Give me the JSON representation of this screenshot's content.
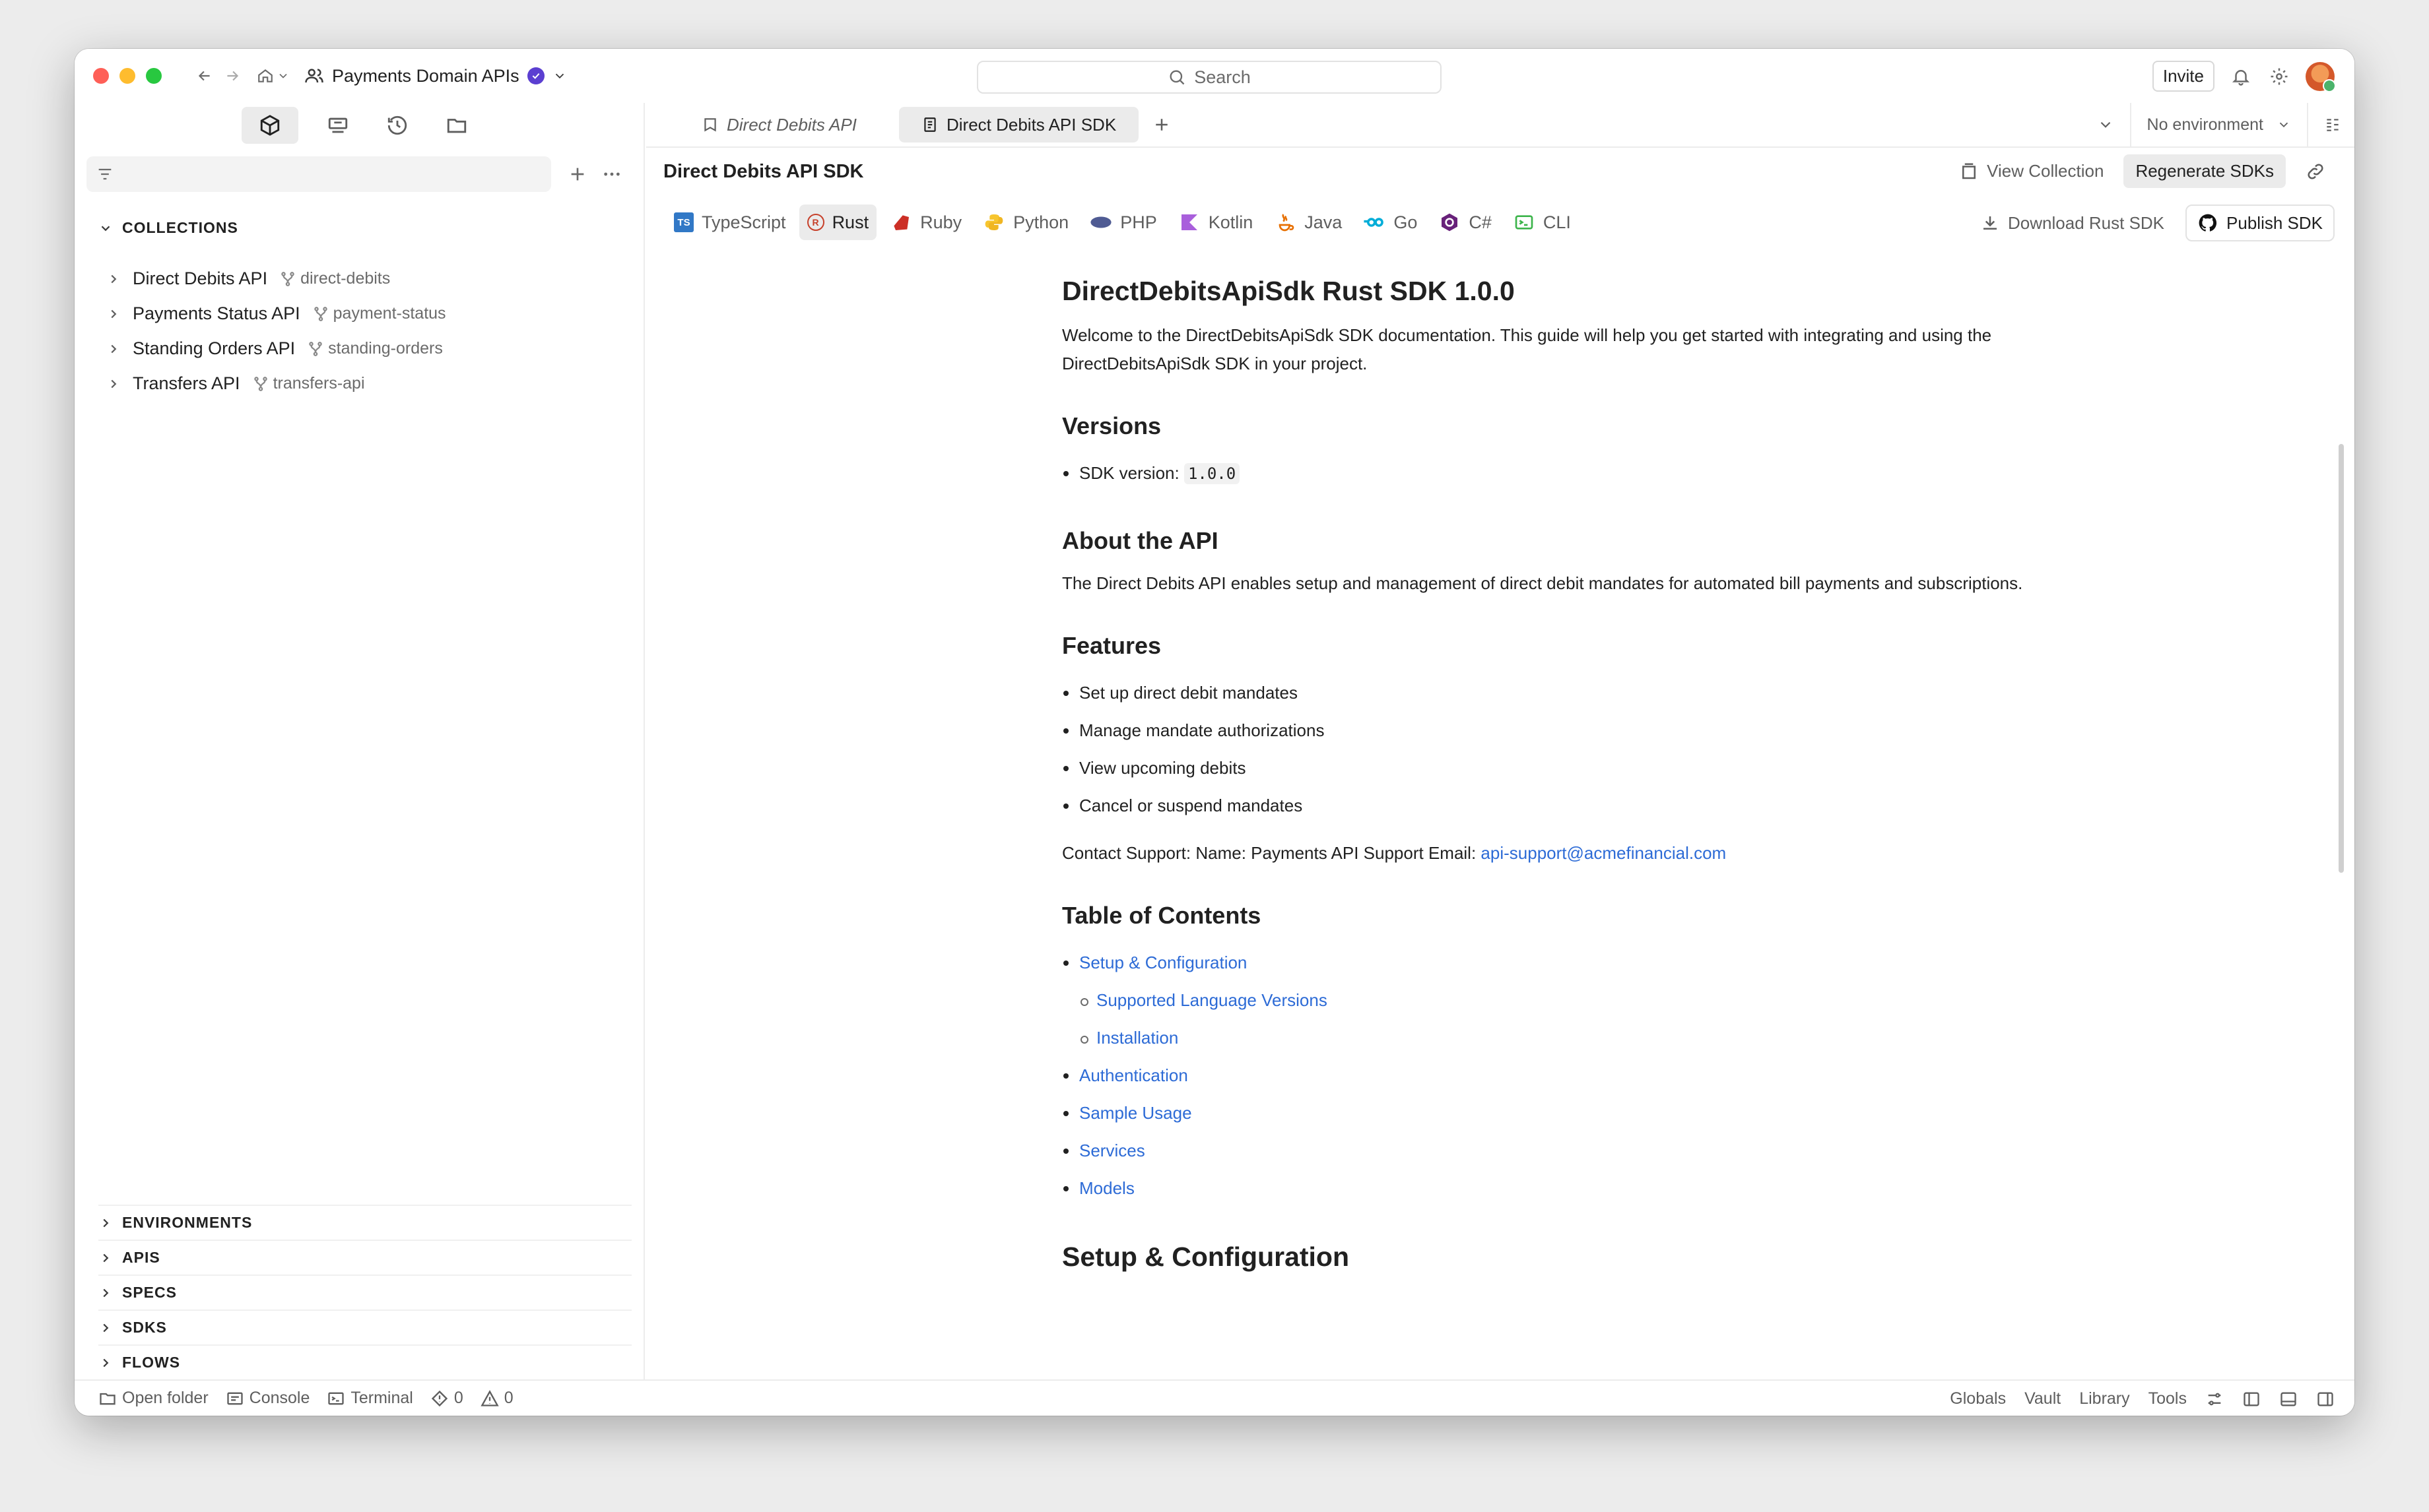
{
  "workspace": {
    "name": "Payments Domain APIs"
  },
  "search": {
    "placeholder": "Search"
  },
  "header": {
    "invite_label": "Invite"
  },
  "sidebar": {
    "collections_heading": "COLLECTIONS",
    "collections": [
      {
        "name": "Direct Debits API",
        "slug": "direct-debits"
      },
      {
        "name": "Payments Status API",
        "slug": "payment-status"
      },
      {
        "name": "Standing Orders API",
        "slug": "standing-orders"
      },
      {
        "name": "Transfers API",
        "slug": "transfers-api"
      }
    ],
    "bottom_sections": [
      "ENVIRONMENTS",
      "APIS",
      "SPECS",
      "SDKS",
      "FLOWS"
    ]
  },
  "tabs": [
    {
      "label": "Direct Debits API"
    },
    {
      "label": "Direct Debits API SDK"
    }
  ],
  "environment": {
    "selected": "No environment"
  },
  "doc": {
    "title": "Direct Debits API SDK",
    "view_collection_label": "View Collection",
    "regenerate_label": "Regenerate SDKs",
    "download_label": "Download Rust SDK",
    "publish_label": "Publish SDK"
  },
  "languages": [
    {
      "label": "TypeScript",
      "badge": "TS",
      "color": "#3178c6"
    },
    {
      "label": "Rust",
      "badge": "R",
      "color": "#c7402a"
    },
    {
      "label": "Ruby",
      "badge": "",
      "color": "#cc2f26"
    },
    {
      "label": "Python",
      "badge": "",
      "color": "#f7c52e"
    },
    {
      "label": "PHP",
      "badge": "",
      "color": "#4f5b93"
    },
    {
      "label": "Kotlin",
      "badge": "",
      "color": "#a95fdc"
    },
    {
      "label": "Java",
      "badge": "",
      "color": "#e76f00"
    },
    {
      "label": "Go",
      "badge": "",
      "color": "#00add8"
    },
    {
      "label": "C#",
      "badge": "C",
      "color": "#68217a"
    },
    {
      "label": "CLI",
      "badge": ">_",
      "color": "#3cb44b"
    }
  ],
  "article": {
    "h1": "DirectDebitsApiSdk Rust SDK 1.0.0",
    "intro": "Welcome to the DirectDebitsApiSdk SDK documentation. This guide will help you get started with integrating and using the DirectDebitsApiSdk SDK in your project.",
    "versions_heading": "Versions",
    "version_label": "SDK version: ",
    "version_value": "1.0.0",
    "about_heading": "About the API",
    "about_text": "The Direct Debits API enables setup and management of direct debit mandates for automated bill payments and subscriptions.",
    "features_heading": "Features",
    "features": [
      "Set up direct debit mandates",
      "Manage mandate authorizations",
      "View upcoming debits",
      "Cancel or suspend mandates"
    ],
    "contact_text": "Contact Support: Name: Payments API Support Email: ",
    "contact_email": "api-support@acmefinancial.com",
    "toc_heading": "Table of Contents",
    "toc": [
      {
        "label": "Setup & Configuration",
        "level": 1
      },
      {
        "label": "Supported Language Versions",
        "level": 2
      },
      {
        "label": "Installation",
        "level": 2
      },
      {
        "label": "Authentication",
        "level": 1
      },
      {
        "label": "Sample Usage",
        "level": 1
      },
      {
        "label": "Services",
        "level": 1
      },
      {
        "label": "Models",
        "level": 1
      }
    ],
    "setup_heading": "Setup & Configuration"
  },
  "statusbar": {
    "open_folder": "Open folder",
    "console": "Console",
    "terminal": "Terminal",
    "errors": "0",
    "warnings": "0",
    "globals": "Globals",
    "vault": "Vault",
    "library": "Library",
    "tools": "Tools"
  },
  "colors": {
    "link": "#2d6bd6",
    "accent_purple": "#5b3fd1"
  }
}
